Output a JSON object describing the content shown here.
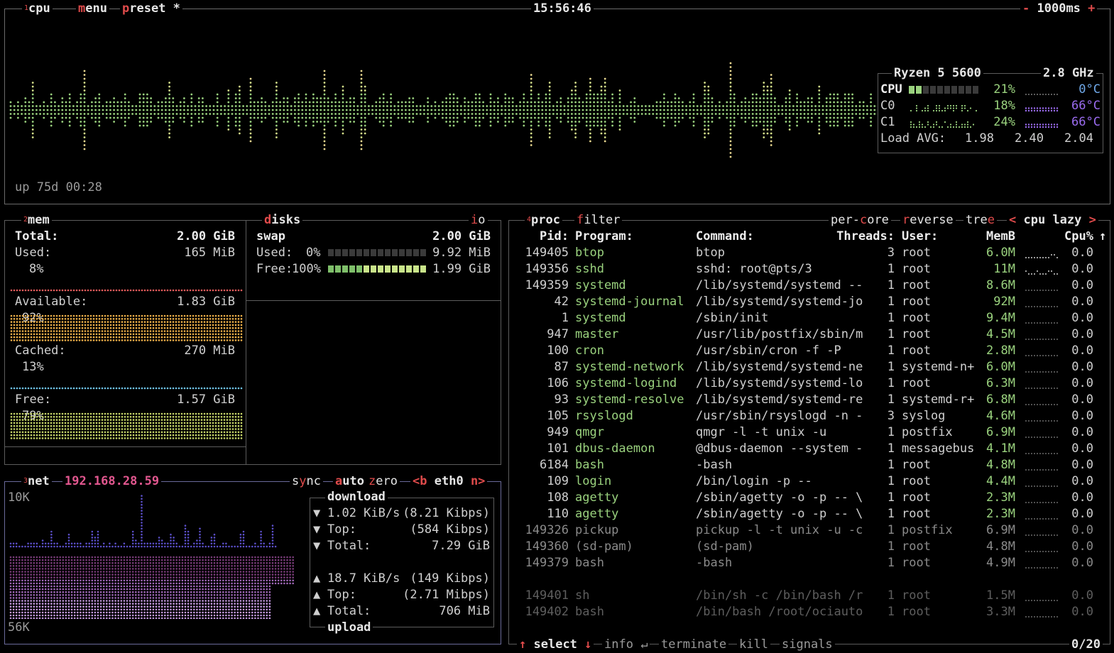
{
  "cpu": {
    "title_num": "1",
    "title": "cpu",
    "menu": "menu",
    "preset": "preset *",
    "clock": "15:56:46",
    "interval": "1000ms",
    "minus": "-",
    "plus": "+",
    "uptime": "up 75d 00:28",
    "model": "Ryzen 5 5600",
    "freq": "2.8 GHz",
    "rows": [
      {
        "label": "CPU",
        "pct": "21%",
        "temp": "0°C"
      },
      {
        "label": "C0",
        "pct": "18%",
        "temp": "66°C"
      },
      {
        "label": "C1",
        "pct": "24%",
        "temp": "66°C"
      }
    ],
    "load_label": "Load AVG:",
    "load": [
      "1.98",
      "2.40",
      "2.04"
    ]
  },
  "mem": {
    "title_num": "2",
    "title": "mem",
    "total_label": "Total:",
    "total": "2.00 GiB",
    "used_label": "Used:",
    "used": "165 MiB",
    "used_pct": "8%",
    "avail_label": "Available:",
    "avail": "1.83 GiB",
    "avail_pct": "92%",
    "cached_label": "Cached:",
    "cached": "270 MiB",
    "cached_pct": "13%",
    "free_label": "Free:",
    "free": "1.57 GiB",
    "free_pct": "79%",
    "colors": {
      "used": "#e85c5c",
      "avail": "#f0b24a",
      "cached": "#6fc3e8",
      "free": "#c9d86a"
    }
  },
  "disks": {
    "title": "disks",
    "io": "io",
    "swap_label": "swap",
    "swap_total": "2.00 GiB",
    "used_label": "Used:",
    "used_pct": "0%",
    "used": "9.92 MiB",
    "free_label": "Free:",
    "free_pct": "100%",
    "free": "1.99 GiB"
  },
  "net": {
    "title_num": "3",
    "title": "net",
    "ip": "192.168.28.59",
    "sync": "sync",
    "auto": "auto",
    "zero": "zero",
    "b": "<b",
    "iface": "eth0",
    "n": "n>",
    "scale_top": "10K",
    "scale_bottom": "56K",
    "download_label": "download",
    "upload_label": "upload",
    "down": {
      "rate": "1.02 KiB/s",
      "rate_bits": "(8.21 Kibps)",
      "top_label": "Top:",
      "top": "(584 Kibps)",
      "total_label": "Total:",
      "total": "7.29 GiB"
    },
    "up": {
      "rate": "18.7 KiB/s",
      "rate_bits": "(149 Kibps)",
      "top_label": "Top:",
      "top": "(2.71 Mibps)",
      "total_label": "Total:",
      "total": "706 MiB"
    }
  },
  "proc": {
    "title_num": "4",
    "title": "proc",
    "filter": "filter",
    "per_core": "per-core",
    "reverse": "reverse",
    "tree": "tree",
    "sort": "cpu lazy",
    "sort_left": "<",
    "sort_right": ">",
    "headers": {
      "pid": "Pid:",
      "program": "Program:",
      "command": "Command:",
      "threads": "Threads:",
      "user": "User:",
      "memb": "MemB",
      "cpu": "Cpu%"
    },
    "rows": [
      {
        "pid": "149405",
        "program": "btop",
        "command": "btop",
        "threads": "3",
        "user": "root",
        "mem": "6.0M",
        "cpu": "0.0"
      },
      {
        "pid": "149356",
        "program": "sshd",
        "command": "sshd: root@pts/3",
        "threads": "1",
        "user": "root",
        "mem": "11M",
        "cpu": "0.0"
      },
      {
        "pid": "149359",
        "program": "systemd",
        "command": "/lib/systemd/systemd --",
        "threads": "1",
        "user": "root",
        "mem": "8.6M",
        "cpu": "0.0"
      },
      {
        "pid": "42",
        "program": "systemd-journal",
        "command": "/lib/systemd/systemd-jo",
        "threads": "1",
        "user": "root",
        "mem": "92M",
        "cpu": "0.0"
      },
      {
        "pid": "1",
        "program": "systemd",
        "command": "/sbin/init",
        "threads": "1",
        "user": "root",
        "mem": "9.4M",
        "cpu": "0.0"
      },
      {
        "pid": "947",
        "program": "master",
        "command": "/usr/lib/postfix/sbin/m",
        "threads": "1",
        "user": "root",
        "mem": "4.5M",
        "cpu": "0.0"
      },
      {
        "pid": "100",
        "program": "cron",
        "command": "/usr/sbin/cron -f -P",
        "threads": "1",
        "user": "root",
        "mem": "2.8M",
        "cpu": "0.0"
      },
      {
        "pid": "87",
        "program": "systemd-network",
        "command": "/lib/systemd/systemd-ne",
        "threads": "1",
        "user": "systemd-n+",
        "mem": "6.0M",
        "cpu": "0.0"
      },
      {
        "pid": "106",
        "program": "systemd-logind",
        "command": "/lib/systemd/systemd-lo",
        "threads": "1",
        "user": "root",
        "mem": "6.3M",
        "cpu": "0.0"
      },
      {
        "pid": "93",
        "program": "systemd-resolve",
        "command": "/lib/systemd/systemd-re",
        "threads": "1",
        "user": "systemd-r+",
        "mem": "6.8M",
        "cpu": "0.0"
      },
      {
        "pid": "105",
        "program": "rsyslogd",
        "command": "/usr/sbin/rsyslogd -n -",
        "threads": "3",
        "user": "syslog",
        "mem": "4.6M",
        "cpu": "0.0"
      },
      {
        "pid": "949",
        "program": "qmgr",
        "command": "qmgr -l -t unix -u",
        "threads": "1",
        "user": "postfix",
        "mem": "6.9M",
        "cpu": "0.0"
      },
      {
        "pid": "101",
        "program": "dbus-daemon",
        "command": "@dbus-daemon --system -",
        "threads": "1",
        "user": "messagebus",
        "mem": "4.1M",
        "cpu": "0.0"
      },
      {
        "pid": "6184",
        "program": "bash",
        "command": "-bash",
        "threads": "1",
        "user": "root",
        "mem": "4.8M",
        "cpu": "0.0"
      },
      {
        "pid": "109",
        "program": "login",
        "command": "/bin/login -p --",
        "threads": "1",
        "user": "root",
        "mem": "4.4M",
        "cpu": "0.0"
      },
      {
        "pid": "108",
        "program": "agetty",
        "command": "/sbin/agetty -o -p -- \\",
        "threads": "1",
        "user": "root",
        "mem": "2.3M",
        "cpu": "0.0"
      },
      {
        "pid": "110",
        "program": "agetty",
        "command": "/sbin/agetty -o -p -- \\",
        "threads": "1",
        "user": "root",
        "mem": "2.3M",
        "cpu": "0.0"
      },
      {
        "pid": "149326",
        "program": "pickup",
        "command": "pickup -l -t unix -u -c",
        "threads": "1",
        "user": "postfix",
        "mem": "6.9M",
        "cpu": "0.0"
      },
      {
        "pid": "149360",
        "program": "(sd-pam)",
        "command": "(sd-pam)",
        "threads": "1",
        "user": "root",
        "mem": "4.8M",
        "cpu": "0.0"
      },
      {
        "pid": "149379",
        "program": "bash",
        "command": "-bash",
        "threads": "1",
        "user": "root",
        "mem": "4.9M",
        "cpu": "0.0"
      },
      {
        "pid": "149401",
        "program": "sh",
        "command": "/bin/sh -c /bin/bash /r",
        "threads": "1",
        "user": "root",
        "mem": "1.5M",
        "cpu": "0.0"
      },
      {
        "pid": "149402",
        "program": "bash",
        "command": "/bin/bash /root/ociauto",
        "threads": "1",
        "user": "root",
        "mem": "3.3M",
        "cpu": "0.0"
      }
    ],
    "footer": {
      "select": "select",
      "info": "info",
      "terminate": "terminate",
      "kill": "kill",
      "signals": "signals",
      "count": "0/20"
    }
  }
}
